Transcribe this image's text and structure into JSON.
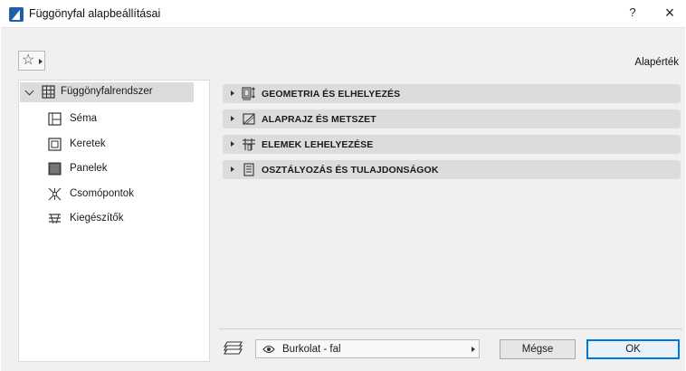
{
  "window": {
    "title": "Függönyfal alapbeállításai",
    "help_label": "?",
    "close_label": "×"
  },
  "toolbar": {
    "favorites_icon": "star-icon",
    "default_label": "Alapérték"
  },
  "tree": {
    "root": {
      "label": "Függönyfalrendszer",
      "icon": "curtain-wall-icon"
    },
    "items": [
      {
        "label": "Séma",
        "icon": "scheme-icon"
      },
      {
        "label": "Keretek",
        "icon": "frames-icon"
      },
      {
        "label": "Panelek",
        "icon": "panels-icon"
      },
      {
        "label": "Csomópontok",
        "icon": "junctions-icon"
      },
      {
        "label": "Kiegészítők",
        "icon": "accessories-icon"
      }
    ]
  },
  "sections": [
    {
      "label": "GEOMETRIA ÉS ELHELYEZÉS",
      "icon": "geometry-icon"
    },
    {
      "label": "ALAPRAJZ ÉS METSZET",
      "icon": "floorplan-icon"
    },
    {
      "label": "ELEMEK LEHELYEZÉSE",
      "icon": "placement-icon"
    },
    {
      "label": "OSZTÁLYOZÁS ÉS TULAJDONSÁGOK",
      "icon": "classification-icon"
    }
  ],
  "footer": {
    "layer_label": "Burkolat - fal",
    "cancel_label": "Mégse",
    "ok_label": "OK"
  },
  "colors": {
    "accent": "#0078d7",
    "selection": "#dcdcdc",
    "app_icon": "#1f5ea8"
  }
}
